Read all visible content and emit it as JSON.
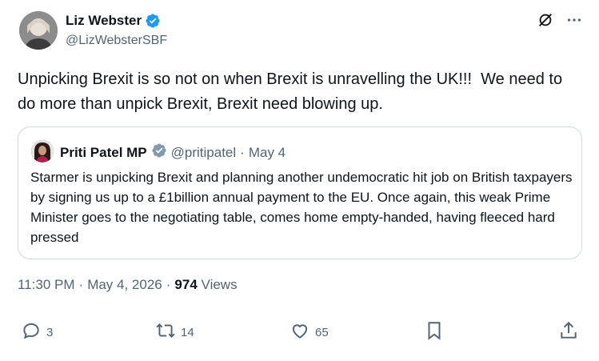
{
  "author": {
    "name": "Liz Webster",
    "handle": "@LizWebsterSBF"
  },
  "tweet": {
    "text": "Unpicking Brexit is so not on when Brexit is unravelling the UK!!!  We need to do more than unpick Brexit, Brexit need blowing up."
  },
  "quote": {
    "name": "Priti Patel MP",
    "handle": "@pritipatel",
    "separator": "·",
    "date": "May 4",
    "text": "Starmer is unpicking Brexit and planning another undemocratic hit job on British taxpayers by signing us up to a £1billion annual payment to the EU. Once again, this weak Prime Minister goes to the negotiating table, comes home empty-handed, having fleeced hard pressed"
  },
  "meta": {
    "time": "11:30 PM",
    "sep1": "·",
    "date": "May 4, 2026",
    "sep2": "·",
    "views_count": "974",
    "views_label": "Views"
  },
  "actions": {
    "replies": "3",
    "reposts": "14",
    "likes": "65"
  },
  "colors": {
    "verified": "#1d9bf0",
    "text_secondary": "#536471",
    "border": "#cfd9de"
  }
}
